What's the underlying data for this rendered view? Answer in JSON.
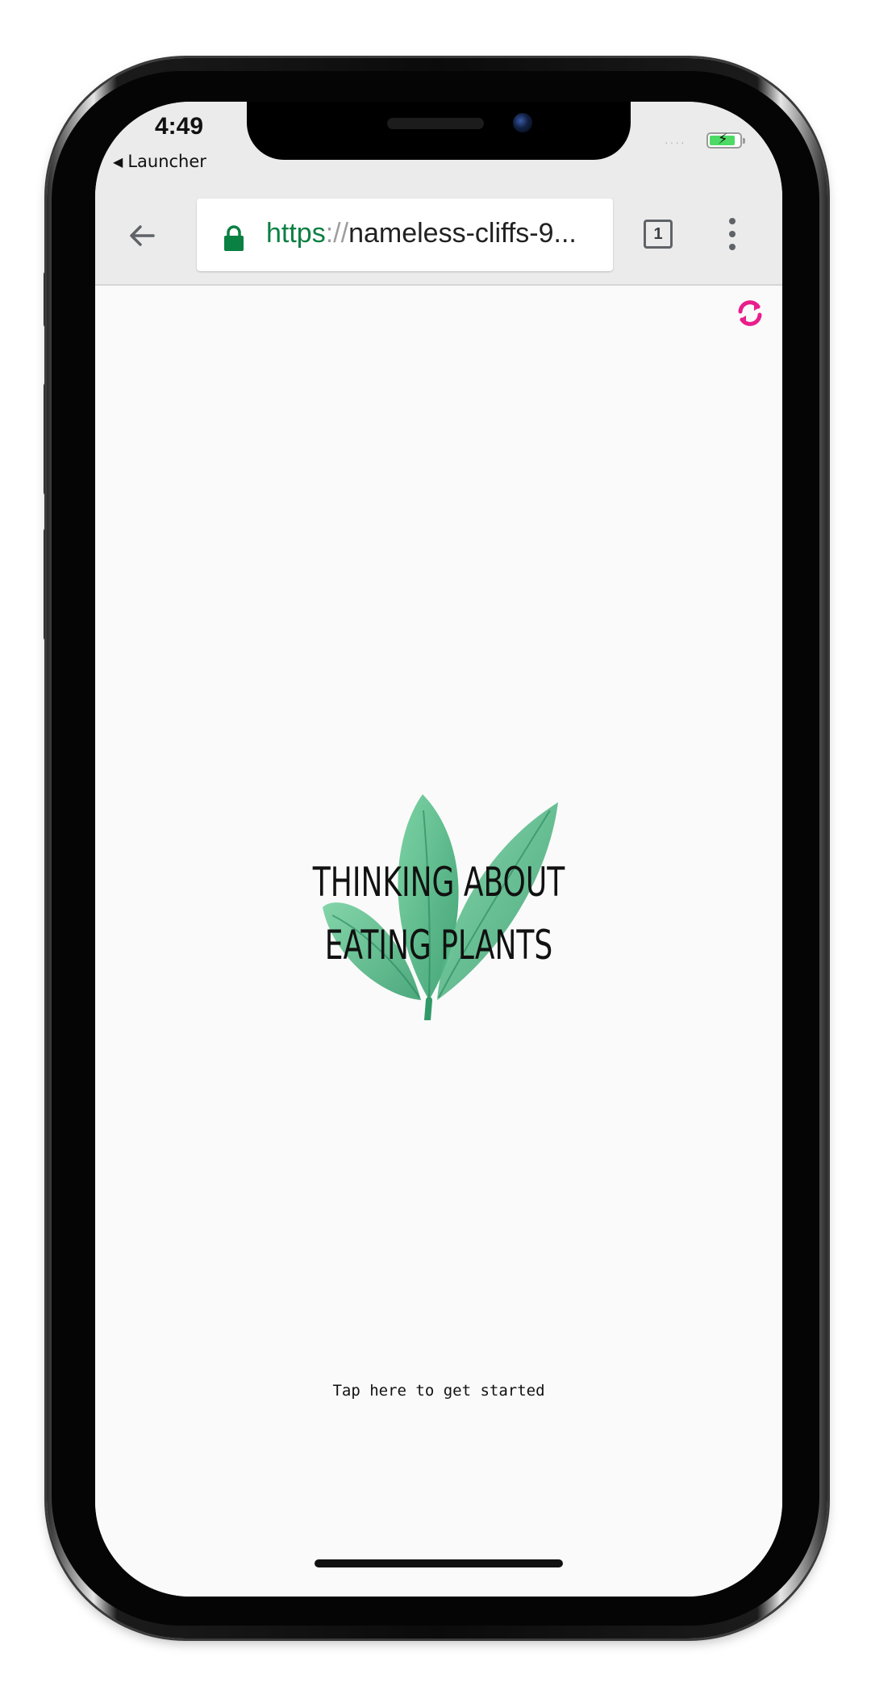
{
  "status_bar": {
    "time": "4:49",
    "back_app": "Launcher",
    "back_glyph": "◀",
    "signal": "····",
    "battery_level": 0.85,
    "battery_color": "#4cd964"
  },
  "browser": {
    "url_scheme": "https",
    "url_separator": "://",
    "url_host": "nameless-cliffs-9...",
    "tab_count": "1",
    "secure_color": "#0b8043",
    "icons": {
      "back": "back-arrow-icon",
      "lock": "lock-icon",
      "tabs": "tab-switcher-icon",
      "menu": "more-vert-icon"
    }
  },
  "page": {
    "title": "THINKING ABOUT EATING PLANTS",
    "cta": "Tap here to get started",
    "refresh_icon": "refresh-icon",
    "refresh_color": "#e91e8c",
    "leaf_color": "#3fae7a"
  }
}
